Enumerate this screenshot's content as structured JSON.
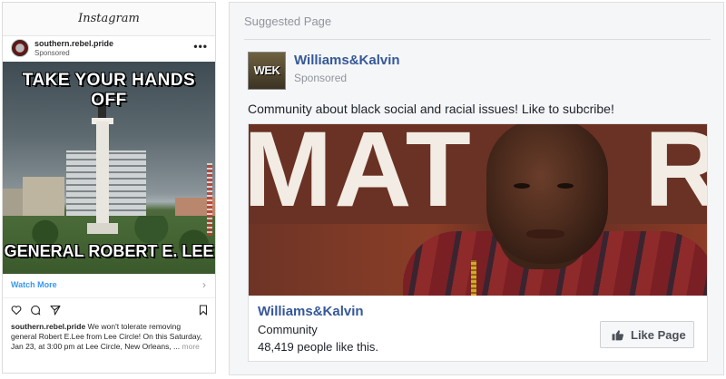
{
  "instagram": {
    "app_title": "Instagram",
    "username": "southern.rebel.pride",
    "sponsored": "Sponsored",
    "image_caption_top": "TAKE YOUR HANDS OFF",
    "image_caption_bottom": "GENERAL ROBERT E. LEE",
    "watch_more": "Watch More",
    "caption_user": "southern.rebel.pride",
    "caption_text": " We won't tolerate removing general Robert E.Lee from Lee Circle! On this Saturday, Jan 23, at 3:00 pm at Lee Circle, New Orleans, ...",
    "more_label": "more",
    "icons": [
      "heart-icon",
      "comment-icon",
      "share-icon",
      "bookmark-icon",
      "chevron-right-icon",
      "more-icon"
    ]
  },
  "facebook": {
    "section_title": "Suggested Page",
    "page_logo_text": "WEK",
    "page_name": "Williams&Kalvin",
    "sponsored": "Sponsored",
    "description": "Community about black social and racial issues! Like to subcribe!",
    "photo_sign_text": "MAT",
    "photo_sign_text_right": "R",
    "card_page_name": "Williams&Kalvin",
    "category": "Community",
    "likes": "48,419 people like this.",
    "like_button": "Like Page",
    "link_color": "#365899",
    "icons": [
      "thumbs-up-icon"
    ]
  }
}
